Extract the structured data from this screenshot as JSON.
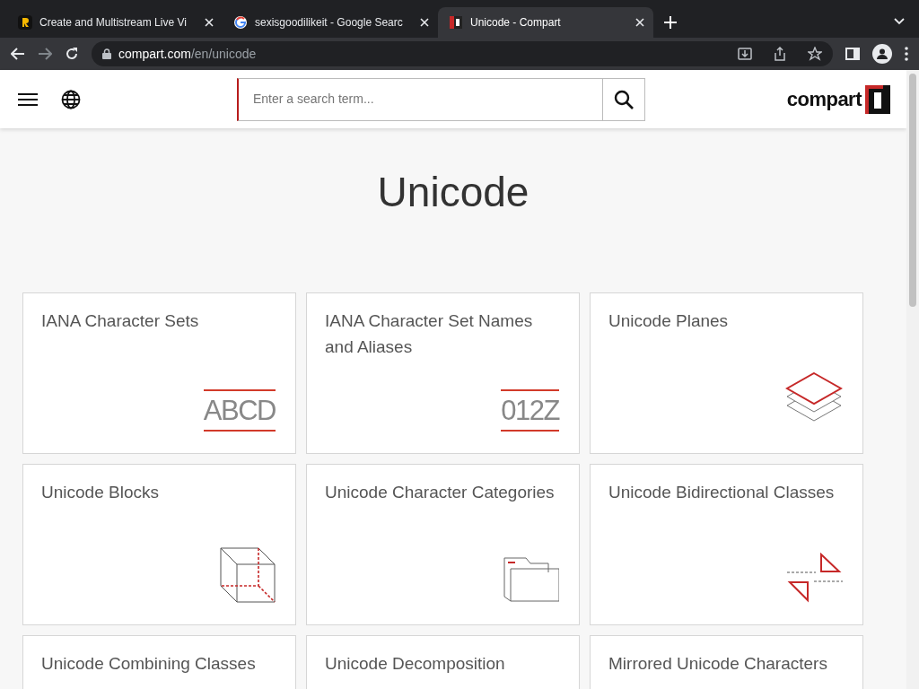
{
  "browser": {
    "tabs": [
      {
        "title": "Create and Multistream Live Vi",
        "selected": false
      },
      {
        "title": "sexisgoodilikeit - Google Searc",
        "selected": false
      },
      {
        "title": "Unicode - Compart",
        "selected": true
      }
    ],
    "address": {
      "host": "compart.com",
      "path": "/en/unicode"
    }
  },
  "header": {
    "search": {
      "placeholder": "Enter a search term..."
    },
    "logo": "compart"
  },
  "title": "Unicode",
  "cards": [
    {
      "title": "IANA Character Sets",
      "glyph_text": "ABCD"
    },
    {
      "title": "IANA Character Set Names and Aliases",
      "glyph_text": "012Z"
    },
    {
      "title": "Unicode Planes"
    },
    {
      "title": "Unicode Blocks"
    },
    {
      "title": "Unicode Character Categories"
    },
    {
      "title": "Unicode Bidirectional Classes"
    },
    {
      "title": "Unicode Combining Classes"
    },
    {
      "title": "Unicode Decomposition"
    },
    {
      "title": "Mirrored Unicode Characters"
    }
  ]
}
